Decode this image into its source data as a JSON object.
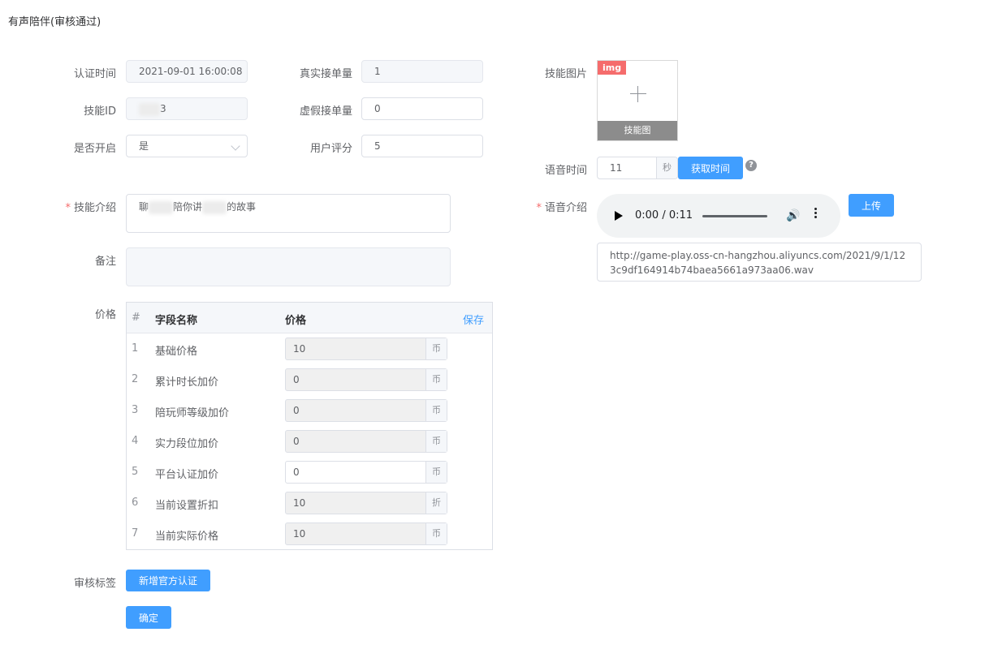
{
  "page": {
    "title": "有声陪伴(审核通过)"
  },
  "form": {
    "auth_time": {
      "label": "认证时间",
      "value": "2021-09-01 16:00:08"
    },
    "real_orders": {
      "label": "真实接单量",
      "value": "1"
    },
    "skill_id": {
      "label": "技能ID",
      "value": "3"
    },
    "fake_orders": {
      "label": "虚假接单量",
      "value": "0"
    },
    "enabled": {
      "label": "是否开启",
      "value": "是"
    },
    "rating": {
      "label": "用户评分",
      "value": "5"
    },
    "skill_intro": {
      "label": "技能介绍",
      "value_parts": [
        "聊",
        "陪你讲",
        "的故事"
      ]
    },
    "remark": {
      "label": "备注",
      "value": ""
    },
    "price": {
      "label": "价格"
    },
    "audit_tag": {
      "label": "审核标签",
      "button": "新增官方认证"
    },
    "confirm_button": "确定"
  },
  "price_table": {
    "headers": {
      "num": "#",
      "name": "字段名称",
      "price": "价格",
      "save": "保存"
    },
    "rows": [
      {
        "num": "1",
        "name": "基础价格",
        "value": "10",
        "unit": "币",
        "editable": false
      },
      {
        "num": "2",
        "name": "累计时长加价",
        "value": "0",
        "unit": "币",
        "editable": false
      },
      {
        "num": "3",
        "name": "陪玩师等级加价",
        "value": "0",
        "unit": "币",
        "editable": false
      },
      {
        "num": "4",
        "name": "实力段位加价",
        "value": "0",
        "unit": "币",
        "editable": false
      },
      {
        "num": "5",
        "name": "平台认证加价",
        "value": "0",
        "unit": "币",
        "editable": true
      },
      {
        "num": "6",
        "name": "当前设置折扣",
        "value": "10",
        "unit": "折",
        "editable": false
      },
      {
        "num": "7",
        "name": "当前实际价格",
        "value": "10",
        "unit": "币",
        "editable": false
      }
    ]
  },
  "media": {
    "skill_image": {
      "label": "技能图片",
      "tag": "img",
      "caption": "技能图"
    },
    "voice_time": {
      "label": "语音时间",
      "value": "11",
      "unit": "秒",
      "button": "获取时间",
      "help": "?"
    },
    "voice_intro": {
      "label": "语音介绍",
      "player_time": "0:00 / 0:11",
      "upload_button": "上传",
      "url": "http://game-play.oss-cn-hangzhou.aliyuncs.com/2021/9/1/123c9df164914b74baea5661a973aa06.wav"
    }
  }
}
